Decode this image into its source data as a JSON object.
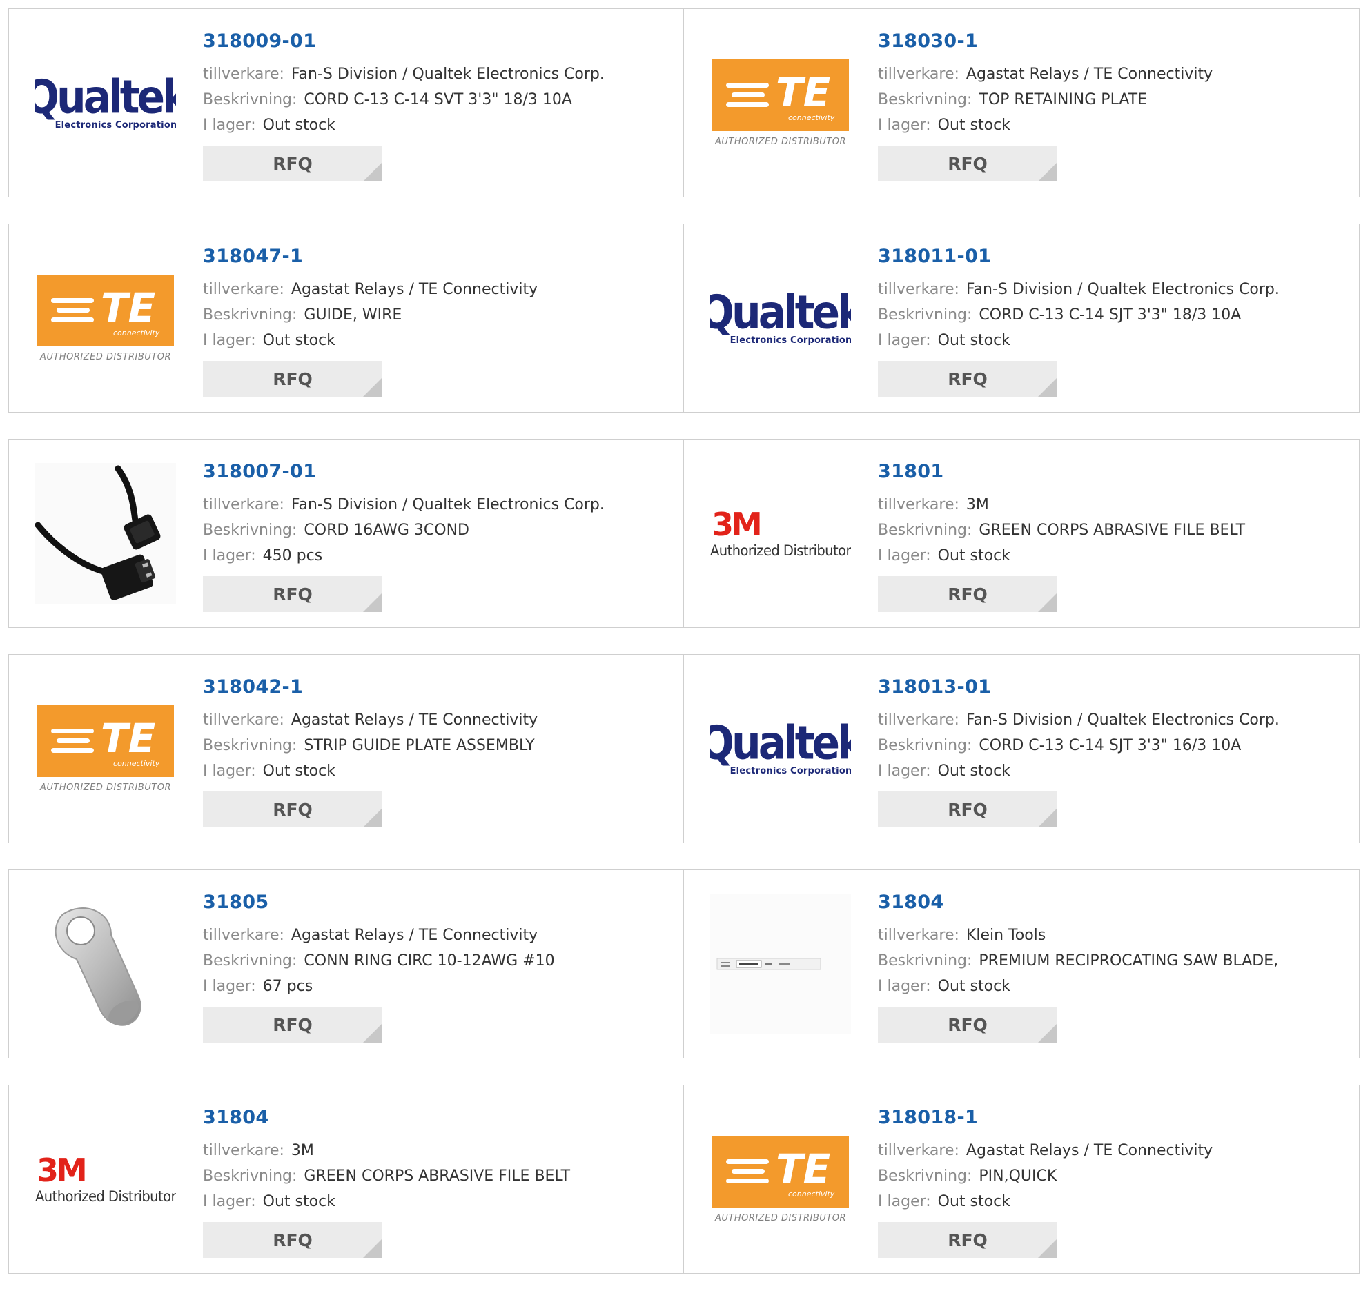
{
  "labels": {
    "manufacturer": "tillverkare:",
    "description": "Beskrivning:",
    "stock": "I lager:",
    "rfq": "RFQ"
  },
  "logos": {
    "qualtek": {
      "word": "Qualtek",
      "sub": "Electronics Corporation"
    },
    "te": {
      "word": "TE",
      "sub": "connectivity",
      "auth": "AUTHORIZED DISTRIBUTOR"
    },
    "threem": {
      "word": "3M",
      "auth": "Authorized Distributor"
    }
  },
  "colors": {
    "part_number": "#1a5fa8",
    "te_orange": "#f39a2c",
    "qualtek_blue": "#1c2877",
    "threem_red": "#e2231a"
  },
  "products": [
    {
      "part": "318009-01",
      "logo": "qualtek",
      "manufacturer": "Fan-S Division / Qualtek Electronics Corp.",
      "description": "CORD C-13 C-14 SVT 3'3\" 18/3 10A",
      "stock": "Out stock"
    },
    {
      "part": "318030-1",
      "logo": "te",
      "manufacturer": "Agastat Relays / TE Connectivity",
      "description": "TOP RETAINING PLATE",
      "stock": "Out stock"
    },
    {
      "part": "318047-1",
      "logo": "te",
      "manufacturer": "Agastat Relays / TE Connectivity",
      "description": "GUIDE, WIRE",
      "stock": "Out stock"
    },
    {
      "part": "318011-01",
      "logo": "qualtek",
      "manufacturer": "Fan-S Division / Qualtek Electronics Corp.",
      "description": "CORD C-13 C-14 SJT 3'3\" 18/3 10A",
      "stock": "Out stock"
    },
    {
      "part": "318007-01",
      "logo": "cord-photo",
      "manufacturer": "Fan-S Division / Qualtek Electronics Corp.",
      "description": "CORD 16AWG 3COND",
      "stock": "450 pcs"
    },
    {
      "part": "31801",
      "logo": "threem",
      "manufacturer": "3M",
      "description": "GREEN CORPS ABRASIVE FILE BELT",
      "stock": "Out stock"
    },
    {
      "part": "318042-1",
      "logo": "te",
      "manufacturer": "Agastat Relays / TE Connectivity",
      "description": "STRIP GUIDE PLATE ASSEMBLY",
      "stock": "Out stock"
    },
    {
      "part": "318013-01",
      "logo": "qualtek",
      "manufacturer": "Fan-S Division / Qualtek Electronics Corp.",
      "description": "CORD C-13 C-14 SJT 3'3\" 16/3 10A",
      "stock": "Out stock"
    },
    {
      "part": "31805",
      "logo": "ring-terminal-photo",
      "manufacturer": "Agastat Relays / TE Connectivity",
      "description": "CONN RING CIRC 10-12AWG #10",
      "stock": "67 pcs"
    },
    {
      "part": "31804",
      "logo": "saw-blade-photo",
      "manufacturer": "Klein Tools",
      "description": "PREMIUM RECIPROCATING SAW BLADE,",
      "stock": "Out stock"
    },
    {
      "part": "31804",
      "logo": "threem",
      "manufacturer": "3M",
      "description": "GREEN CORPS ABRASIVE FILE BELT",
      "stock": "Out stock"
    },
    {
      "part": "318018-1",
      "logo": "te",
      "manufacturer": "Agastat Relays / TE Connectivity",
      "description": "PIN,QUICK",
      "stock": "Out stock"
    }
  ]
}
